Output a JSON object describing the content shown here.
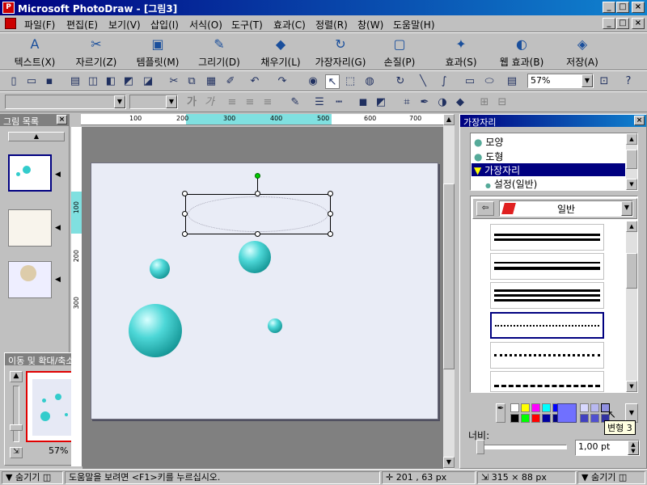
{
  "window": {
    "title": "Microsoft PhotoDraw - [그림3]",
    "app_icon": "photodraw-icon",
    "min": "_",
    "max": "□",
    "close": "×"
  },
  "menu": [
    "파일(F)",
    "편집(E)",
    "보기(V)",
    "삽입(I)",
    "서식(O)",
    "도구(T)",
    "효과(C)",
    "정렬(R)",
    "창(W)",
    "도움말(H)"
  ],
  "visual_menu": [
    {
      "label": "텍스트(X)",
      "icon": "text-icon"
    },
    {
      "label": "자르기(Z)",
      "icon": "scissors-icon"
    },
    {
      "label": "템플릿(M)",
      "icon": "template-icon"
    },
    {
      "label": "그리기(D)",
      "icon": "draw-icon"
    },
    {
      "label": "채우기(L)",
      "icon": "fill-icon"
    },
    {
      "label": "가장자리(G)",
      "icon": "edge-icon"
    },
    {
      "label": "손질(P)",
      "icon": "touchup-icon"
    },
    {
      "label": "효과(S)",
      "icon": "effects-icon"
    },
    {
      "label": "웹 효과(B)",
      "icon": "web-effects-icon"
    },
    {
      "label": "저장(A)",
      "icon": "save-wizard-icon"
    }
  ],
  "toolbar": {
    "zoom": "57%",
    "font_name": "",
    "font_size": "",
    "bold": "가",
    "italic": "가"
  },
  "picture_list": {
    "title": "그림 목록",
    "close": "×"
  },
  "navigator": {
    "title": "이동 및 확대/축소",
    "zoom": "57%"
  },
  "ruler": {
    "h": [
      "100",
      "200",
      "300",
      "400",
      "500",
      "600",
      "700"
    ],
    "v": [
      "100",
      "200",
      "300"
    ]
  },
  "right_panel": {
    "title": "가장자리",
    "tree": [
      {
        "label": "모양",
        "bullet": "circle"
      },
      {
        "label": "도형",
        "bullet": "circle"
      },
      {
        "label": "가장자리",
        "bullet": "triangle",
        "selected": true
      },
      {
        "label": "설정(일반)",
        "bullet": "dot",
        "sub": true
      }
    ],
    "category": "일반",
    "width_label": "너비:",
    "width_value": "1,00 pt",
    "tooltip": "변형 3"
  },
  "palette": {
    "row1": [
      "#ffffff",
      "#ffff00",
      "#ff00ff",
      "#00ffff",
      "#0000ff"
    ],
    "row2": [
      "#000000",
      "#00ff00",
      "#ff0000",
      "#0000a0",
      "#000080"
    ],
    "big": "#7070ff",
    "extra1": [
      "#d8d8ff",
      "#b8b8f0",
      "#9090e0"
    ],
    "extra2": [
      "#4040c0",
      "#5050d0",
      "#3030a0"
    ]
  },
  "status": {
    "left_toggle": "숨기기",
    "help": "도움말을 보려면 <F1>키를 누르십시오.",
    "pos": "201 , 63  px",
    "size": "315 × 88  px",
    "right_toggle": "숨기기"
  }
}
